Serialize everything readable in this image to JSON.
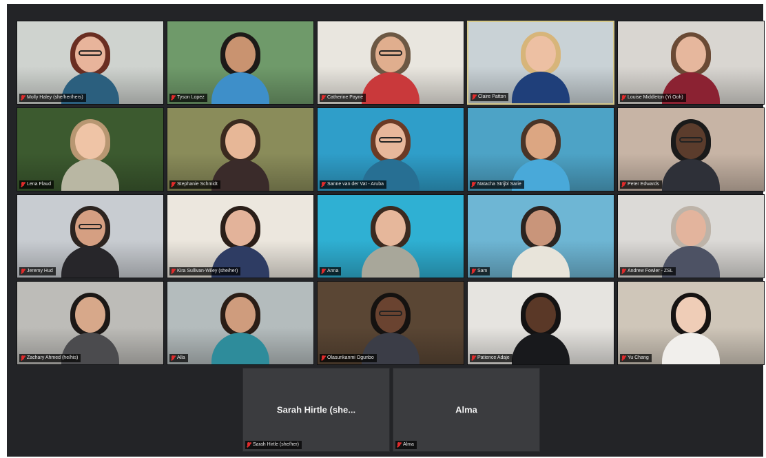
{
  "participants": [
    {
      "name": "Molly Haley (she/her/hers)",
      "bg": "#cfd3cf",
      "hair": "#6a2e22",
      "skin": "#e8b49b",
      "shirt": "#2b5f7e",
      "glasses": true
    },
    {
      "name": "Tyson Lopez",
      "bg": "#6f9a6a",
      "hair": "#1d1a18",
      "skin": "#c99370",
      "shirt": "#3e8fc9",
      "glasses": false
    },
    {
      "name": "Catherine Payne",
      "bg": "#e9e6df",
      "hair": "#6c5844",
      "skin": "#e0ae8e",
      "shirt": "#c9393b",
      "glasses": true
    },
    {
      "name": "Claire Patton",
      "bg": "#c9d2d6",
      "hair": "#d7b57a",
      "skin": "#edc0a3",
      "shirt": "#1f3f7a",
      "glasses": false,
      "active": true
    },
    {
      "name": "Louise Middleton (Yi Ooh)",
      "bg": "#d9d6d1",
      "hair": "#6a4a35",
      "skin": "#e6b79d",
      "shirt": "#8b2232",
      "glasses": false
    },
    {
      "name": "Lena Flaud",
      "bg": "#3c5a2f",
      "hair": "#b89772",
      "skin": "#efc4a6",
      "shirt": "#b9b7a3",
      "glasses": false
    },
    {
      "name": "Stephanie Schmidt",
      "bg": "#8a8c5a",
      "hair": "#3a2a1f",
      "skin": "#e7b797",
      "shirt": "#3a2b2a",
      "glasses": false
    },
    {
      "name": "Sanne van der Vat - Aruba",
      "bg": "#2f9ec9",
      "hair": "#6b3a25",
      "skin": "#e8b79b",
      "shirt": "#276f93",
      "glasses": true
    },
    {
      "name": "Natacha Strijbl Sarie",
      "bg": "#4da3c6",
      "hair": "#4a3427",
      "skin": "#dca682",
      "shirt": "#49a9d9",
      "glasses": false
    },
    {
      "name": "Peter Edwards",
      "bg": "#c7b4a5",
      "hair": "#1a1a1a",
      "skin": "#5b3c2c",
      "shirt": "#2e3038",
      "glasses": true
    },
    {
      "name": "Jeremy Hud",
      "bg": "#c8ccd1",
      "hair": "#2c2420",
      "skin": "#d59f82",
      "shirt": "#27262a",
      "glasses": true
    },
    {
      "name": "Kira Sullivan-Wiley (she/her)",
      "bg": "#ece7de",
      "hair": "#2a1e18",
      "skin": "#e3b39a",
      "shirt": "#2e3c63",
      "glasses": false
    },
    {
      "name": "Anna",
      "bg": "#2fb0d3",
      "hair": "#3b2a20",
      "skin": "#e6b79b",
      "shirt": "#a8a79a",
      "glasses": false
    },
    {
      "name": "Sam",
      "bg": "#6eb6d4",
      "hair": "#2b2420",
      "skin": "#c9957a",
      "shirt": "#e8e4da",
      "glasses": false
    },
    {
      "name": "Andrew Fowler - ZSL",
      "bg": "#dcdad7",
      "hair": "#bdb3a8",
      "skin": "#e3b49d",
      "shirt": "#4d5264",
      "glasses": false
    },
    {
      "name": "Zachary Ahmed (he/his)",
      "bg": "#bdbcb8",
      "hair": "#1c1816",
      "skin": "#d7a88a",
      "shirt": "#4b4b4e",
      "glasses": false
    },
    {
      "name": "Alla",
      "bg": "#b4bcbd",
      "hair": "#2a1d16",
      "skin": "#cf9c7d",
      "shirt": "#2e8c9b",
      "glasses": false
    },
    {
      "name": "Olasunkanmi Ogunbo",
      "bg": "#5a4634",
      "hair": "#151210",
      "skin": "#6a4330",
      "shirt": "#3b3d47",
      "glasses": true
    },
    {
      "name": "Patience Adaje",
      "bg": "#e6e4e0",
      "hair": "#141212",
      "skin": "#5a3827",
      "shirt": "#18191c",
      "glasses": false
    },
    {
      "name": "Yu Chang",
      "bg": "#cfc6b9",
      "hair": "#161312",
      "skin": "#efcdb7",
      "shirt": "#f1efec",
      "glasses": false
    }
  ],
  "avatar_tiles": [
    {
      "display": "Sarah Hirtle (she...",
      "name": "Sarah Hirtle (she/her)"
    },
    {
      "display": "Alma",
      "name": "Alma"
    }
  ]
}
